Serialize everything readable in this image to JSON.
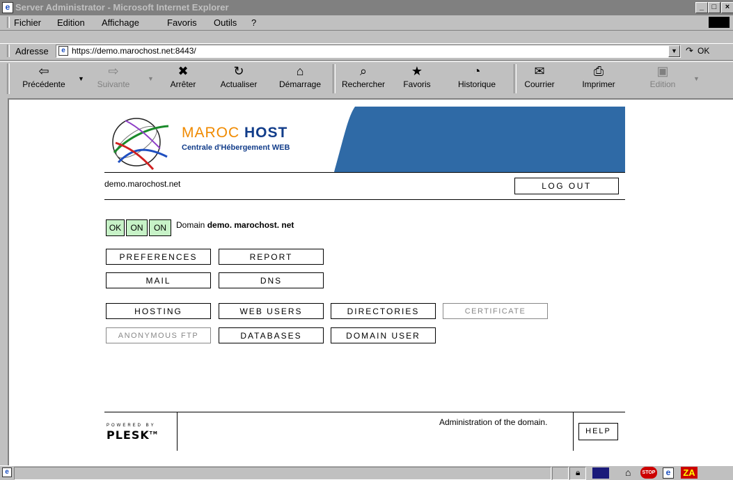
{
  "window": {
    "title": "Server Administrator - Microsoft Internet Explorer",
    "min": "_",
    "max": "□",
    "close": "×"
  },
  "menu": [
    "Fichier",
    "Edition",
    "Affichage",
    "Favoris",
    "Outils",
    "?"
  ],
  "address": {
    "label": "Adresse",
    "url": "https://demo.marochost.net:8443/",
    "go": "OK"
  },
  "toolbar": [
    {
      "label": "Précédente",
      "icon": "⇦"
    },
    {
      "label": "Suivante",
      "icon": "⇨"
    },
    {
      "label": "Arrêter",
      "icon": "✖"
    },
    {
      "label": "Actualiser",
      "icon": "↻"
    },
    {
      "label": "Démarrage",
      "icon": "⌂"
    },
    {
      "label": "Rechercher",
      "icon": "⌕"
    },
    {
      "label": "Favoris",
      "icon": "★"
    },
    {
      "label": "Historique",
      "icon": "◔"
    },
    {
      "label": "Courrier",
      "icon": "✉"
    },
    {
      "label": "Imprimer",
      "icon": "⎙"
    },
    {
      "label": "Edition",
      "icon": "▣"
    }
  ],
  "page": {
    "logo_title_1": "MAROC",
    "logo_title_2": "HOST",
    "logo_sub": "Centrale d'Hébergement WEB",
    "domain_name": "demo.marochost.net",
    "logout": "LOG OUT",
    "status": [
      "OK",
      "ON",
      "ON"
    ],
    "domain_label": "Domain",
    "domain_bold": "demo. marochost. net",
    "buttons": {
      "preferences": "PREFERENCES",
      "report": "REPORT",
      "mail": "MAIL",
      "dns": "DNS",
      "hosting": "HOSTING",
      "web_users": "WEB USERS",
      "directories": "DIRECTORIES",
      "certificate": "CERTIFICATE",
      "anonymous_ftp": "ANONYMOUS FTP",
      "databases": "DATABASES",
      "domain_user": "DOMAIN USER"
    },
    "footer_text": "Administration of the domain.",
    "help": "HELP",
    "powered_by": "POWERED BY",
    "plesk": "PLESK",
    "tm": "TM"
  },
  "colors": {
    "status_green": "#c7f2c7",
    "header_blue": "#2f6aa6"
  }
}
